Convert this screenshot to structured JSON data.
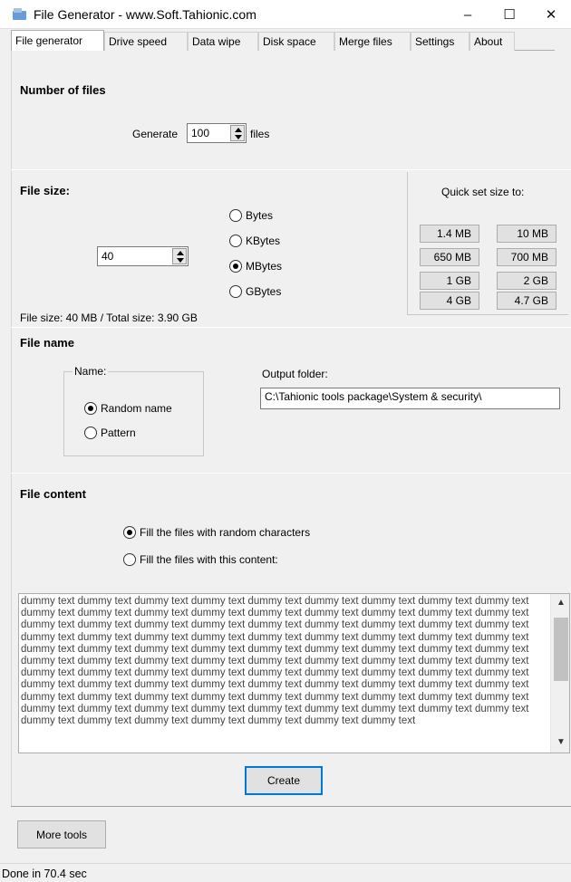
{
  "window": {
    "title": "File Generator  -  www.Soft.Tahionic.com",
    "minimize": "–",
    "maximize": "☐",
    "close": "✕"
  },
  "tabs": [
    "File generator",
    "Drive speed",
    "Data wipe",
    "Disk space",
    "Merge files",
    "Settings",
    "About"
  ],
  "number_of_files": {
    "title": "Number of files",
    "generate_label": "Generate",
    "count": "100",
    "files_label": "files"
  },
  "file_size": {
    "title": "File size:",
    "value": "40",
    "units": [
      "Bytes",
      "KBytes",
      "MBytes",
      "GBytes"
    ],
    "selected_unit": "MBytes",
    "summary": "File size: 40 MB / Total size: 3.90 GB",
    "quick_set_title": "Quick set size to:",
    "quick_set": [
      "1.4 MB",
      "10 MB",
      "650 MB",
      "700 MB",
      "1 GB",
      "2 GB",
      "4 GB",
      "4.7 GB"
    ]
  },
  "file_name": {
    "title": "File name",
    "group_label": "Name:",
    "options": [
      "Random name",
      "Pattern"
    ],
    "selected": "Random name",
    "output_folder_label": "Output folder:",
    "output_folder": "C:\\Tahionic tools package\\System & security\\"
  },
  "file_content": {
    "title": "File content",
    "options": [
      "Fill the files with random characters",
      "Fill the files with this content:"
    ],
    "selected": "Fill the files with random characters",
    "text": "dummy text dummy text dummy text dummy text dummy text dummy text dummy text dummy text dummy text dummy text dummy text dummy text dummy text dummy text dummy text dummy text dummy text dummy text dummy text dummy text dummy text dummy text dummy text dummy text dummy text dummy text dummy text dummy text dummy text dummy text dummy text dummy text dummy text dummy text dummy text dummy text dummy text dummy text dummy text dummy text dummy text dummy text dummy text dummy text dummy text dummy text dummy text dummy text dummy text dummy text dummy text dummy text dummy text dummy text dummy text dummy text dummy text dummy text dummy text dummy text dummy text dummy text dummy text dummy text dummy text dummy text dummy text dummy text dummy text dummy text dummy text dummy text dummy text dummy text dummy text dummy text dummy text dummy text dummy text dummy text dummy text dummy text dummy text dummy text dummy text dummy text dummy text dummy text dummy text dummy text dummy text dummy text dummy text dummy text dummy text dummy text dummy text"
  },
  "actions": {
    "create": "Create",
    "more_tools": "More tools"
  },
  "status": "Done in 70.4 sec"
}
